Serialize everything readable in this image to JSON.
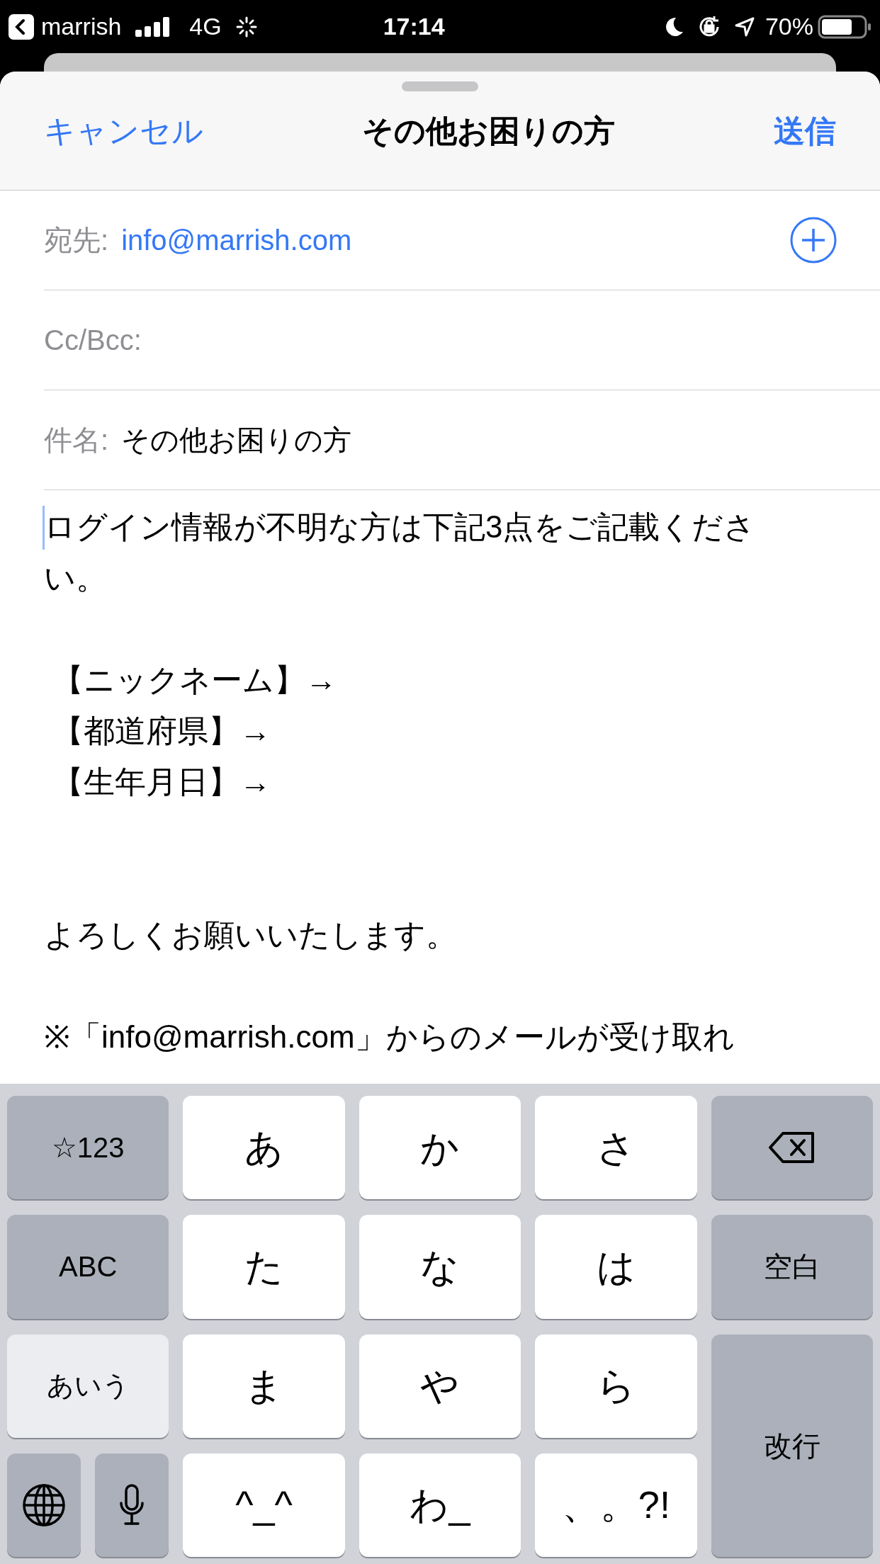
{
  "status_bar": {
    "back_app": "marrish",
    "network": "4G",
    "time": "17:14",
    "battery": "70%"
  },
  "header": {
    "cancel": "キャンセル",
    "title": "その他お困りの方",
    "send": "送信"
  },
  "fields": [
    {
      "label": "宛先:",
      "value": "info@marrish.com",
      "kind": "recipient"
    },
    {
      "label": "Cc/Bcc:",
      "kind": "plain"
    },
    {
      "label": "件名:",
      "value": "その他お困りの方",
      "kind": "plain"
    }
  ],
  "body": [
    {
      "kind": "text",
      "text": "ログイン情報が不明な方は下記3点をご記載ください。"
    },
    {
      "kind": "blank"
    },
    {
      "kind": "text",
      "text": " 【ニックネーム】→"
    },
    {
      "kind": "text",
      "text": " 【都道府県】→"
    },
    {
      "kind": "text",
      "text": " 【生年月日】→"
    },
    {
      "kind": "blank"
    },
    {
      "kind": "blank"
    },
    {
      "kind": "text",
      "text": "よろしくお願いいたします。"
    },
    {
      "kind": "blank"
    },
    {
      "kind": "text",
      "text": "※「info@marrish.com」からのメールが受け取れ"
    }
  ],
  "keyboard": [
    {
      "kind": "function",
      "label": "☆123"
    },
    {
      "kind": "letter",
      "label": "あ"
    },
    {
      "kind": "letter",
      "label": "か"
    },
    {
      "kind": "letter",
      "label": "さ"
    },
    {
      "kind": "delete"
    },
    {
      "kind": "function",
      "label": "ABC"
    },
    {
      "kind": "letter",
      "label": "た"
    },
    {
      "kind": "letter",
      "label": "な"
    },
    {
      "kind": "letter",
      "label": "は"
    },
    {
      "kind": "function",
      "label": "空白"
    },
    {
      "kind": "mode",
      "label": "あいう",
      "selected": true
    },
    {
      "kind": "letter",
      "label": "ま"
    },
    {
      "kind": "letter",
      "label": "や"
    },
    {
      "kind": "letter",
      "label": "ら"
    },
    {
      "kind": "return",
      "label": "改行"
    },
    {
      "kind": "globe_mic"
    },
    {
      "kind": "letter",
      "label": "^_^"
    },
    {
      "kind": "letter",
      "label": "わ_"
    },
    {
      "kind": "letter",
      "label": "、。?!"
    }
  ]
}
